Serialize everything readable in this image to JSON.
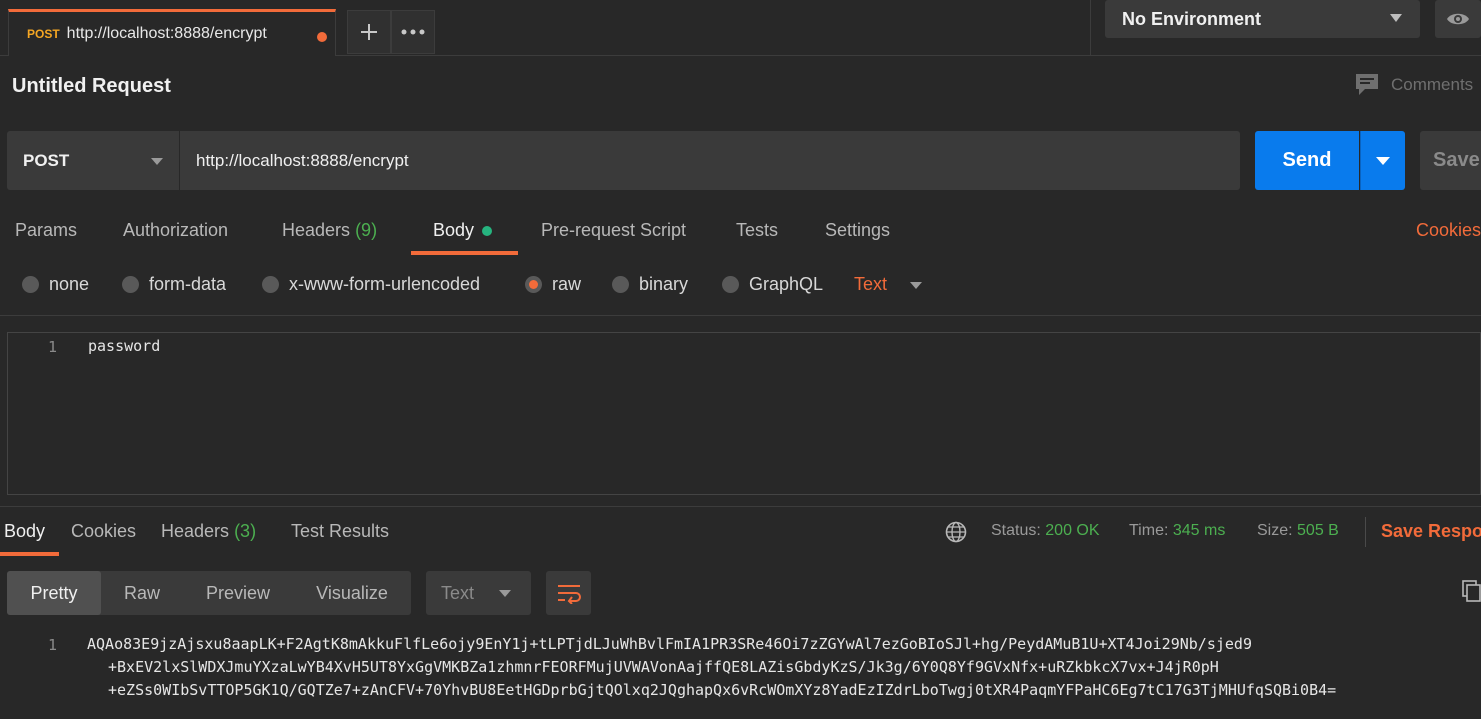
{
  "tab": {
    "method": "POST",
    "url": "http://localhost:8888/encrypt"
  },
  "environment": {
    "selected": "No Environment"
  },
  "request": {
    "title": "Untitled Request",
    "comments_label": "Comments",
    "method": "POST",
    "url": "http://localhost:8888/encrypt",
    "send_label": "Send",
    "save_label": "Save"
  },
  "request_tabs": {
    "params": "Params",
    "authorization": "Authorization",
    "headers": "Headers",
    "headers_count": "(9)",
    "body": "Body",
    "prerequest": "Pre-request Script",
    "tests": "Tests",
    "settings": "Settings",
    "cookies": "Cookies"
  },
  "body_types": {
    "none": "none",
    "form_data": "form-data",
    "urlencoded": "x-www-form-urlencoded",
    "raw": "raw",
    "binary": "binary",
    "graphql": "GraphQL",
    "format": "Text"
  },
  "editor": {
    "line_number": "1",
    "content": "password"
  },
  "response_tabs": {
    "body": "Body",
    "cookies": "Cookies",
    "headers": "Headers",
    "headers_count": "(3)",
    "test_results": "Test Results"
  },
  "response_status": {
    "status_label": "Status:",
    "status_value": "200 OK",
    "time_label": "Time:",
    "time_value": "345 ms",
    "size_label": "Size:",
    "size_value": "505 B",
    "save_response": "Save Respo"
  },
  "response_view": {
    "pretty": "Pretty",
    "raw": "Raw",
    "preview": "Preview",
    "visualize": "Visualize",
    "format": "Text"
  },
  "response_body": {
    "line_number": "1",
    "lines": [
      "AQAo83E9jzAjsxu8aapLK+F2AgtK8mAkkuFlfLe6ojy9EnY1j+tLPTjdLJuWhBvlFmIA1PR3SRe46Oi7zZGYwAl7ezGoBIoSJl+hg/PeydAMuB1U+XT4Joi29Nb/sjed9",
      "+BxEV2lxSlWDXJmuYXzaLwYB4XvH5UT8YxGgVMKBZa1zhmnrFEORFMujUVWAVonAajffQE8LAZisGbdyKzS/Jk3g/6Y0Q8Yf9GVxNfx+uRZkbkcX7vx+J4jR0pH",
      "+eZSs0WIbSvTTOP5GK1Q/GQTZe7+zAnCFV+70YhvBU8EetHGDprbGjtQOlxq2JQghapQx6vRcWOmXYz8YadEzIZdrLboTwgj0tXR4PaqmYFPaHC6Eg7tC17G3TjMHUfqSQBi0B4="
    ]
  }
}
